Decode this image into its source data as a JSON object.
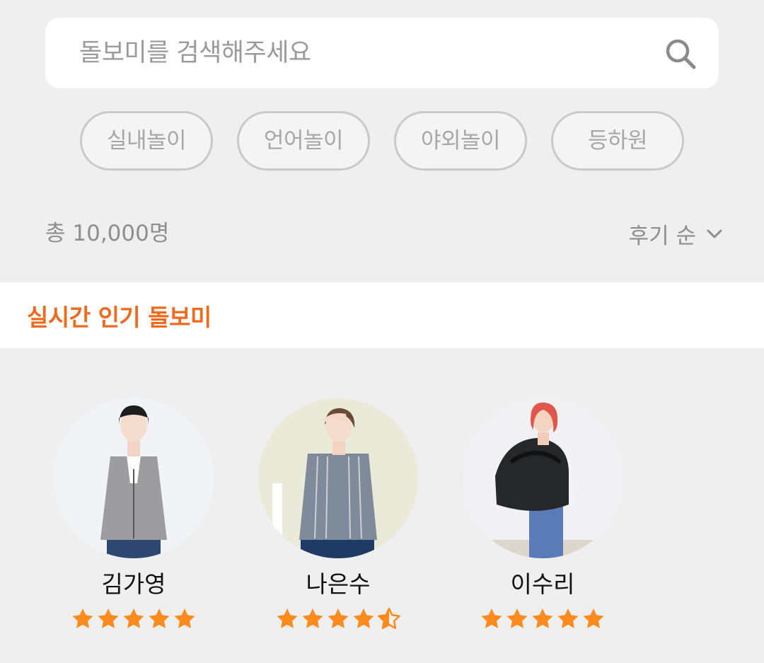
{
  "search": {
    "placeholder": "돌보미를 검색해주세요",
    "icon": "search-icon"
  },
  "chips": [
    {
      "label": "실내놀이"
    },
    {
      "label": "언어놀이"
    },
    {
      "label": "야외놀이"
    },
    {
      "label": "등하원"
    }
  ],
  "summary": {
    "total": "총 10,000명",
    "sort_label": "후기 순",
    "sort_icon": "chevron-down-icon"
  },
  "section": {
    "title": "실시간 인기 돌보미"
  },
  "sitters": [
    {
      "name": "김가영",
      "rating": 5
    },
    {
      "name": "나은수",
      "rating": 4.5
    },
    {
      "name": "이수리",
      "rating": 5
    }
  ],
  "colors": {
    "background": "#efefef",
    "accent": "#ef6a1f",
    "star": "#ff8a1d",
    "chip_border": "#c9c9c9",
    "muted_text": "#8e8e8e"
  }
}
